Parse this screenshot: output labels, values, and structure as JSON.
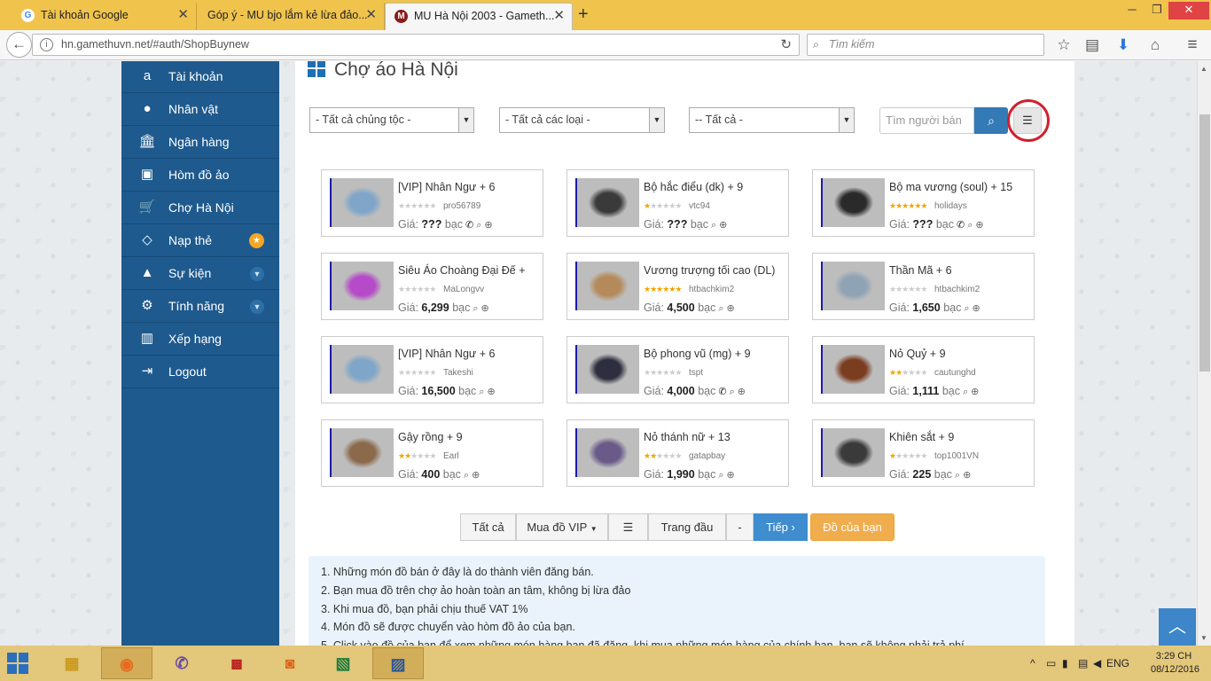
{
  "browser": {
    "tabs": [
      {
        "title": "Tài khoản Google",
        "favicon": "G"
      },
      {
        "title": "Góp ý - MU bjo lắm kẻ lừa đảo...",
        "favicon": ""
      },
      {
        "title": "MU Hà Nội 2003 - Gameth...",
        "favicon": "M"
      }
    ],
    "url": "hn.gamethuvn.net/#auth/ShopBuynew",
    "search_placeholder": "Tìm kiếm"
  },
  "sidebar": {
    "items": [
      {
        "label": "Tài khoản",
        "icon": "amazon-icon"
      },
      {
        "label": "Nhân vật",
        "icon": "user-icon"
      },
      {
        "label": "Ngân hàng",
        "icon": "bank-icon"
      },
      {
        "label": "Hòm đồ ảo",
        "icon": "briefcase-icon"
      },
      {
        "label": "Chợ Hà Nội",
        "icon": "cart-icon"
      },
      {
        "label": "Nạp thẻ",
        "icon": "diamond-icon"
      },
      {
        "label": "Sự kiện",
        "icon": "android-icon"
      },
      {
        "label": "Tính năng",
        "icon": "gears-icon"
      },
      {
        "label": "Xếp hạng",
        "icon": "bar-chart-icon"
      },
      {
        "label": "Logout",
        "icon": "sign-out-icon"
      }
    ]
  },
  "main": {
    "title": "Chợ áo Hà Nội",
    "filters": {
      "race": "- Tất cả chủng tộc -",
      "type": "- Tất cả các loại -",
      "level": "-- Tất cả -",
      "seller_placeholder": "Tìm người bán"
    },
    "items": [
      {
        "name": "[VIP] Nhân Ngư + 6",
        "seller": "pro56789",
        "stars": 0,
        "price": "???",
        "currency": "bạc",
        "phone": true
      },
      {
        "name": "Bộ hắc điểu (dk) + 9",
        "seller": "vtc94",
        "stars": 1,
        "price": "???",
        "currency": "bạc",
        "phone": false
      },
      {
        "name": "Bộ ma vương (soul) + 15",
        "seller": "holidays",
        "stars": 6,
        "price": "???",
        "currency": "bạc",
        "phone": true
      },
      {
        "name": "Siêu Áo Choàng Đại Đế +",
        "seller": "MaLongvv",
        "stars": 0,
        "price": "6,299",
        "currency": "bạc",
        "phone": false
      },
      {
        "name": "Vương trượng tối cao (DL)",
        "seller": "htbachkim2",
        "stars": 6,
        "price": "4,500",
        "currency": "bạc",
        "phone": false
      },
      {
        "name": "Thần Mã + 6",
        "seller": "htbachkim2",
        "stars": 0,
        "price": "1,650",
        "currency": "bạc",
        "phone": false
      },
      {
        "name": "[VIP] Nhân Ngư + 6",
        "seller": "Takeshi",
        "stars": 0,
        "price": "16,500",
        "currency": "bạc",
        "phone": false
      },
      {
        "name": "Bộ phong vũ (mg) + 9",
        "seller": "tspt",
        "stars": 0,
        "price": "4,000",
        "currency": "bạc",
        "phone": true
      },
      {
        "name": "Nỏ Quỷ + 9",
        "seller": "cautunghd",
        "stars": 2,
        "price": "1,111",
        "currency": "bạc",
        "phone": false
      },
      {
        "name": "Gậy rồng + 9",
        "seller": "Earl",
        "stars": 2,
        "price": "400",
        "currency": "bạc",
        "phone": false
      },
      {
        "name": "Nỏ thánh nữ + 13",
        "seller": "gatapbay",
        "stars": 2,
        "price": "1,990",
        "currency": "bạc",
        "phone": false
      },
      {
        "name": "Khiên sắt + 9",
        "seller": "top1001VN",
        "stars": 1,
        "price": "225",
        "currency": "bạc",
        "phone": false
      }
    ],
    "price_label": "Giá:",
    "pager": {
      "all": "Tất cả",
      "vip": "Mua đồ VIP",
      "first": "Trang đầu",
      "dash": "-",
      "next": "Tiếp",
      "mine": "Đồ của bạn"
    },
    "notes": [
      "1. Những món đồ bán ở đây là do thành viên đăng bán.",
      "2. Bạn mua đồ trên chợ ảo hoàn toàn an tâm, không bị lừa đảo",
      "3. Khi mua đồ, bạn phải chịu thuế VAT 1%",
      "4. Món đồ sẽ được chuyển vào hòm đồ ảo của bạn.",
      "5. Click vào đồ của bạn để xem những món hàng bạn đã đăng, khi mua những món hàng của chính bạn, bạn sẽ không phải trả phí"
    ]
  },
  "taskbar": {
    "lang": "ENG",
    "time": "3:29 CH",
    "date": "08/12/2016"
  }
}
